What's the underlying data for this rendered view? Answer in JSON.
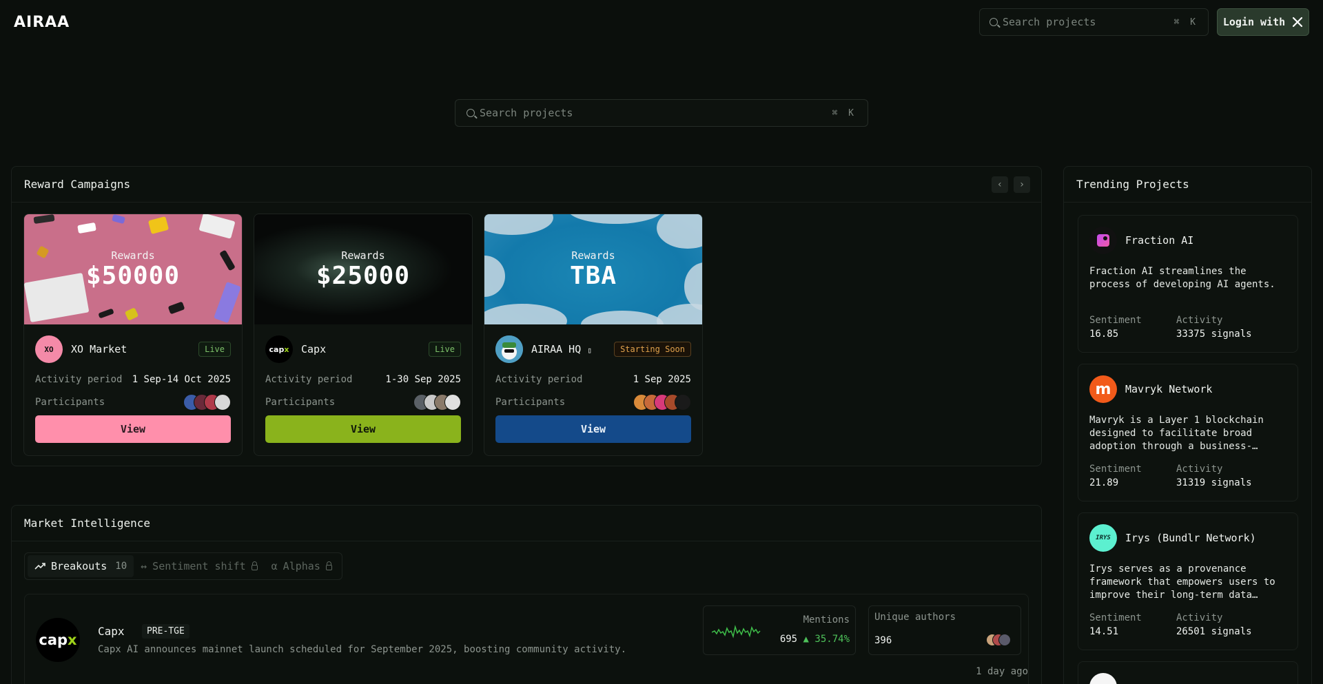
{
  "header": {
    "logo": "AIRAA",
    "search_placeholder": "Search projects",
    "search_shortcut": "⌘ K",
    "login_label": "Login with",
    "login_icon": "x-logo-icon"
  },
  "main_search": {
    "placeholder": "Search projects",
    "shortcut": "⌘ K"
  },
  "rewards": {
    "title": "Reward Campaigns",
    "prev_icon": "chevron-left-icon",
    "next_icon": "chevron-right-icon",
    "cards": [
      {
        "rewards_label": "Rewards",
        "amount": "$50000",
        "name": "XO Market",
        "status": "Live",
        "period_label": "Activity period",
        "period": "1 Sep-14 Oct 2025",
        "participants_label": "Participants",
        "view_label": "View",
        "accent": "#ff8fab"
      },
      {
        "rewards_label": "Rewards",
        "amount": "$25000",
        "name": "Capx",
        "status": "Live",
        "period_label": "Activity period",
        "period": "1-30 Sep 2025",
        "participants_label": "Participants",
        "view_label": "View",
        "accent": "#8ab31c"
      },
      {
        "rewards_label": "Rewards",
        "amount": "TBA",
        "name": "AIRAA HQ",
        "name_suffix": "▯",
        "status": "Starting Soon",
        "period_label": "Activity period",
        "period": "1 Sep 2025",
        "participants_label": "Participants",
        "view_label": "View",
        "accent": "#144a8a"
      }
    ]
  },
  "market": {
    "title": "Market Intelligence",
    "tabs": [
      {
        "label": "Breakouts",
        "count": "10",
        "icon": "trending-up-icon",
        "locked": false
      },
      {
        "label": "Sentiment shift",
        "icon": "arrows-horizontal-icon",
        "locked": true
      },
      {
        "label": "Alphas",
        "icon": "alpha-icon",
        "locked": true
      }
    ],
    "item": {
      "logo_text": "cap",
      "logo_accent": "x",
      "name": "Capx",
      "tag": "PRE-TGE",
      "description": "Capx AI announces mainnet launch scheduled for September 2025, boosting community activity.",
      "mentions_label": "Mentions",
      "mentions_value": "695",
      "mentions_change": "35.74%",
      "authors_label": "Unique authors",
      "authors_value": "396",
      "time": "1 day ago"
    }
  },
  "trending": {
    "title": "Trending Projects",
    "items": [
      {
        "name": "Fraction AI",
        "description": "Fraction AI streamlines the process of developing AI agents.",
        "sentiment_label": "Sentiment",
        "sentiment": "16.85",
        "activity_label": "Activity",
        "activity": "33375 signals"
      },
      {
        "name": "Mavryk Network",
        "description": "Mavryk is a Layer 1 blockchain designed to facilitate broad adoption through a business-…",
        "sentiment_label": "Sentiment",
        "sentiment": "21.89",
        "activity_label": "Activity",
        "activity": "31319 signals"
      },
      {
        "name": "Irys (Bundlr Network)",
        "description": "Irys serves as a provenance framework that empowers users to improve their long-term data…",
        "sentiment_label": "Sentiment",
        "sentiment": "14.51",
        "activity_label": "Activity",
        "activity": "26501 signals"
      }
    ]
  }
}
